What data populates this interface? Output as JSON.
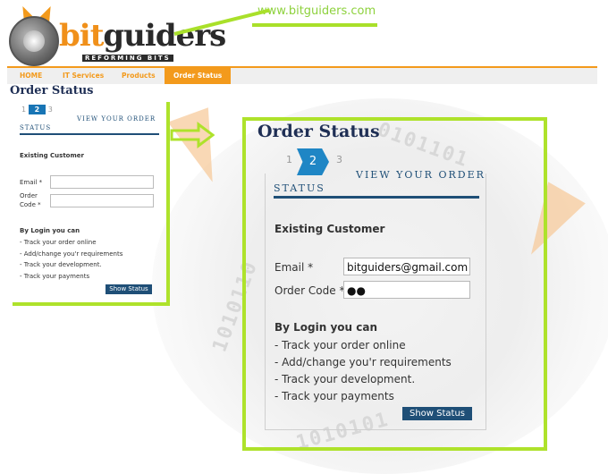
{
  "header": {
    "logo_prefix": "bit",
    "logo_suffix": "guiders",
    "logo_tagline": "REFORMING BITS",
    "site_url": "www.bitguiders.com"
  },
  "nav": {
    "items": [
      {
        "label": "HOME"
      },
      {
        "label": "IT Services"
      },
      {
        "label": "Products"
      },
      {
        "label": "Order Status"
      }
    ],
    "active_index": 3
  },
  "small_panel": {
    "title": "Order Status",
    "steps": [
      "1",
      "2",
      "3"
    ],
    "current_step": "2",
    "view_order": "VIEW YOUR ORDER",
    "status": "STATUS",
    "existing_customer": "Existing Customer",
    "email_label": "Email *",
    "order_code_label_1": "Order",
    "order_code_label_2": "Code *",
    "login_heading": "By Login you can",
    "bullets": [
      "- Track your order online",
      "- Add/change you'r requirements",
      "- Track your development.",
      "- Track your payments"
    ],
    "button": "Show Status"
  },
  "main_panel": {
    "title": "Order Status",
    "steps": [
      "1",
      "2",
      "3"
    ],
    "current_step": "2",
    "view_order": "VIEW YOUR ORDER",
    "status": "STATUS",
    "existing_customer": "Existing Customer",
    "email_label": "Email *",
    "email_value": "bitguiders@gmail.com",
    "order_code_label": "Order Code *",
    "order_code_value": "●●",
    "login_heading": "By Login you can",
    "bullets": [
      "- Track your order online",
      "- Add/change you'r requirements",
      "- Track your development.",
      "- Track your payments"
    ],
    "button": "Show Status"
  },
  "colors": {
    "accent_orange": "#f39a1c",
    "highlight_green": "#aee22b",
    "heading_navy": "#1f2f55",
    "step_blue": "#1f86c5",
    "button_navy": "#1f4f77"
  }
}
